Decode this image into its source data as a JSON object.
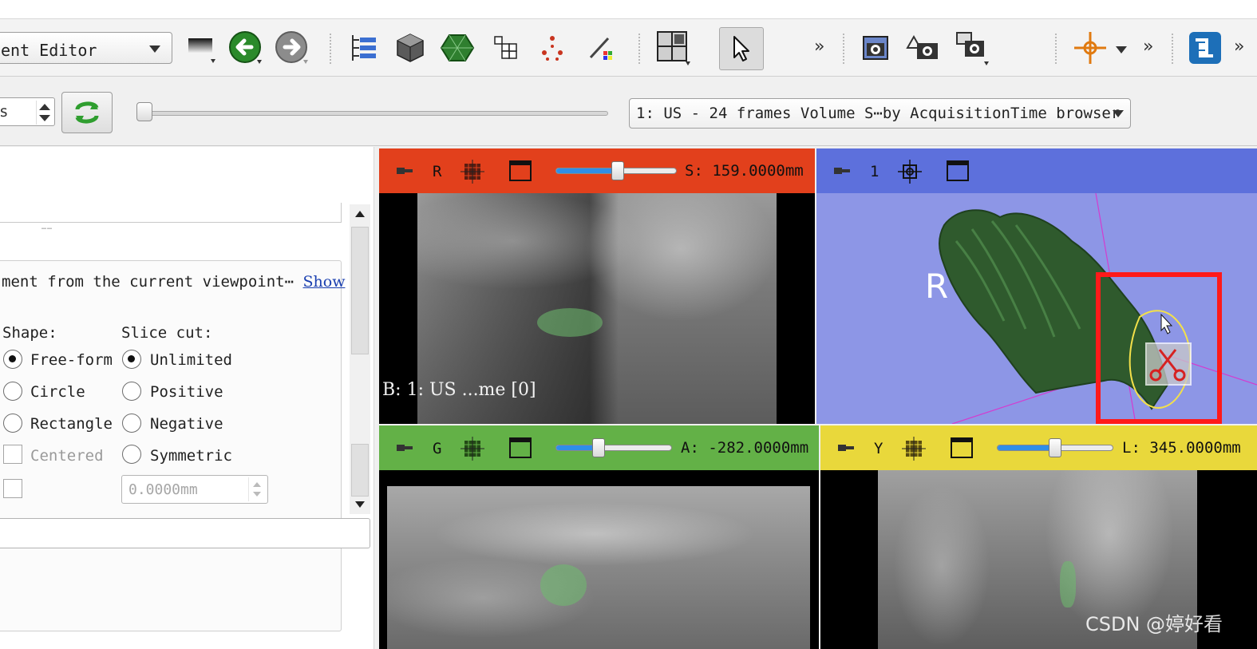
{
  "toolbar": {
    "module_selector": "ent Editor",
    "buttons": [
      {
        "name": "window-level-icon"
      },
      {
        "name": "back-arrow-icon"
      },
      {
        "name": "forward-arrow-icon"
      },
      {
        "name": "data-tree-icon"
      },
      {
        "name": "volume-cube-icon"
      },
      {
        "name": "model-icon"
      },
      {
        "name": "grid-layout-icon"
      },
      {
        "name": "markups-icon"
      },
      {
        "name": "editor-icon"
      },
      {
        "name": "layout-icon"
      },
      {
        "name": "pointer-icon"
      },
      {
        "name": "screenshot-icon"
      },
      {
        "name": "scene-view-icon"
      },
      {
        "name": "scene-views-icon"
      },
      {
        "name": "crosshair-icon"
      },
      {
        "name": "extension-icon"
      }
    ],
    "overflow_glyph": "»"
  },
  "sequence_row": {
    "spin_value": "s",
    "browser_selector": "1: US - 24 frames Volume S⋯by AcquisitionTime browser"
  },
  "left_panel": {
    "description": "ment from the current viewpoint⋯",
    "show_link": "Show",
    "shape_heading": "Shape:",
    "slice_cut_heading": "Slice cut:",
    "shape_options": [
      "Free-form",
      "Circle",
      "Rectangle"
    ],
    "shape_selected": "Free-form",
    "centered_label": "Centered",
    "slice_cut_options": [
      "Unlimited",
      "Positive",
      "Negative",
      "Symmetric"
    ],
    "slice_cut_selected": "Unlimited",
    "thickness_value": "0.0000mm",
    "grip_dots": "……"
  },
  "views": {
    "red": {
      "name": "R",
      "offset": "S: 159.0000mm",
      "slider_fraction": 0.51,
      "bar_color": "#e2401c",
      "corner_text": "B: 1: US ...me [0]"
    },
    "threed": {
      "name": "1",
      "bar_color": "#5d70dc",
      "orientation_label": "R",
      "bg_color": "#8d96e6"
    },
    "green": {
      "name": "G",
      "offset": "A: -282.0000mm",
      "slider_fraction": 0.37,
      "bar_color": "#63b147"
    },
    "yellow": {
      "name": "Y",
      "offset": "L: 345.0000mm",
      "slider_fraction": 0.5,
      "bar_color": "#e9d83b"
    }
  },
  "watermark": "CSDN @婷好看",
  "colors": {
    "highlight_box": "#ff1a1a",
    "segment_green": "#2f5a2d"
  }
}
